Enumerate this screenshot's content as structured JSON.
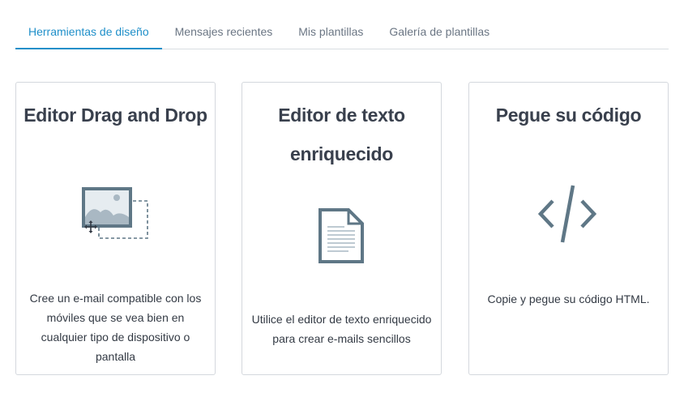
{
  "tabs": [
    {
      "label": "Herramientas de diseño",
      "active": true
    },
    {
      "label": "Mensajes recientes",
      "active": false
    },
    {
      "label": "Mis plantillas",
      "active": false
    },
    {
      "label": "Galería de plantillas",
      "active": false
    }
  ],
  "cards": [
    {
      "title": "Editor Drag and Drop",
      "icon": "drag-drop-image-icon",
      "description": "Cree un e-mail compatible con los móviles que se vea bien en cualquier tipo de dispositivo o pantalla"
    },
    {
      "title": "Editor de texto enriquecido",
      "icon": "document-icon",
      "description": "Utilice el editor de texto enriquecido para crear e-mails sencillos"
    },
    {
      "title": "Pegue su código",
      "icon": "code-icon",
      "description": "Copie y pegue su código HTML."
    }
  ],
  "colors": {
    "accent": "#1f8fc9",
    "icon": "#5f7786",
    "text": "#39404d"
  }
}
